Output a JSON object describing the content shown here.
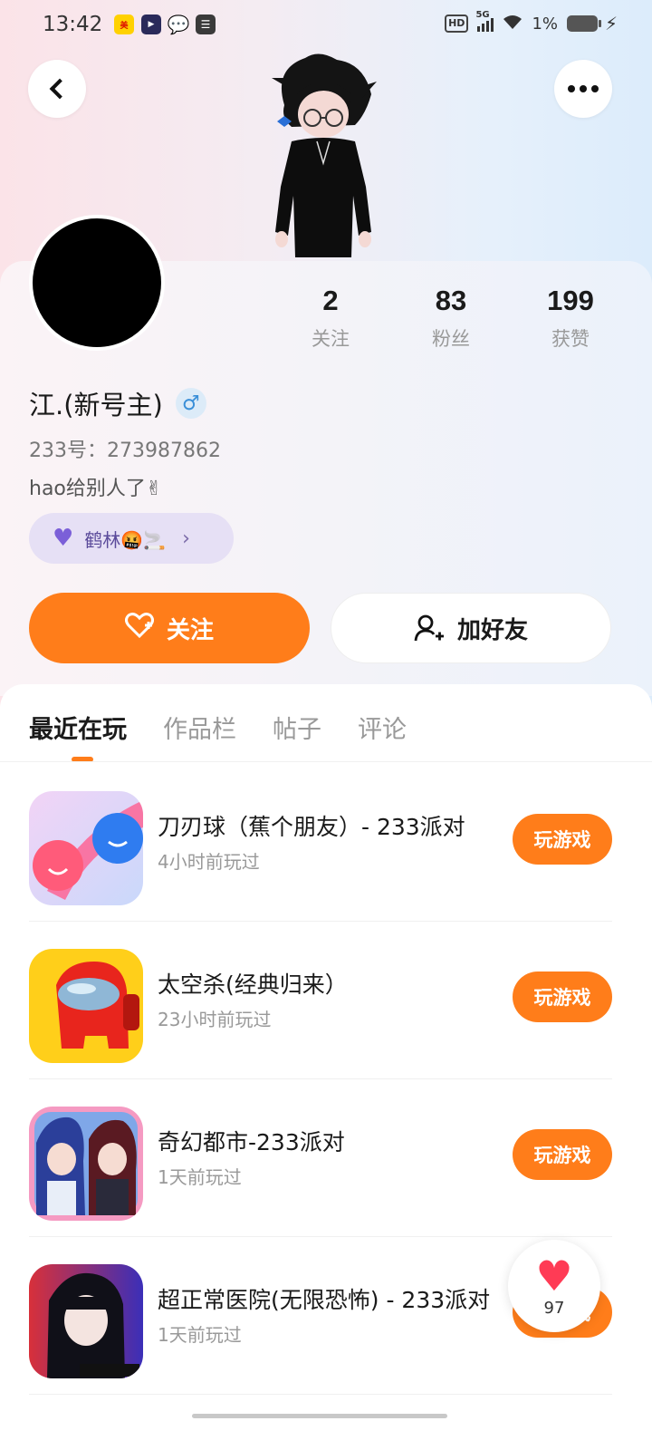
{
  "status_bar": {
    "time": "13:42",
    "network": "5G",
    "hd": "HD",
    "battery": "1%"
  },
  "header": {
    "back_icon": "chevron-left-icon",
    "more_icon": "more-dots-icon"
  },
  "profile": {
    "stats": [
      {
        "value": "2",
        "label": "关注"
      },
      {
        "value": "83",
        "label": "粉丝"
      },
      {
        "value": "199",
        "label": "获赞"
      }
    ],
    "username": "江.(新号主)",
    "gender_symbol": "♂",
    "uid": "233号：273987862",
    "bio": "hao给别人了✌",
    "club": "鹤林🤬🚬"
  },
  "actions": {
    "follow_label": "关注",
    "add_friend_label": "加好友"
  },
  "tabs": [
    "最近在玩",
    "作品栏",
    "帖子",
    "评论"
  ],
  "games": [
    {
      "title": "刀刃球（蕉个朋友）- 233派对",
      "time": "4小时前玩过",
      "button": "玩游戏"
    },
    {
      "title": "太空杀(经典归来）",
      "time": "23小时前玩过",
      "button": "玩游戏"
    },
    {
      "title": "奇幻都市-233派对",
      "time": "1天前玩过",
      "button": "玩游戏"
    },
    {
      "title": "超正常医院(无限恐怖) - 233派对",
      "time": "1天前玩过",
      "button": "玩游戏"
    }
  ],
  "floating_like": {
    "count": "97"
  },
  "colors": {
    "accent": "#ff7d1a",
    "like": "#ff3b55",
    "club_bg": "#e6e0f5"
  }
}
